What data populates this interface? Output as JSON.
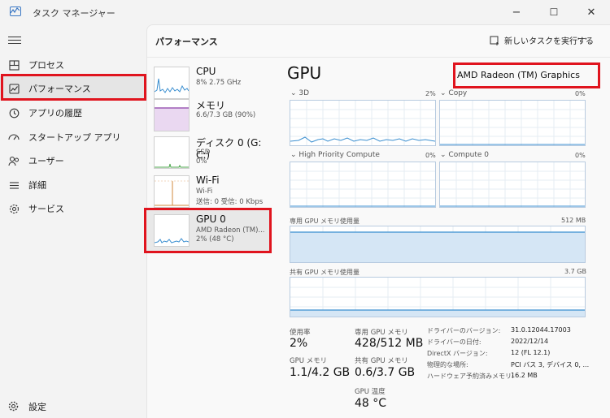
{
  "app": {
    "title": "タスク マネージャー",
    "minimize": "−",
    "maximize": "☐",
    "close": "✕"
  },
  "sidebar": {
    "items": [
      {
        "label": "プロセス",
        "icon": "processes-icon"
      },
      {
        "label": "パフォーマンス",
        "icon": "performance-icon"
      },
      {
        "label": "アプリの履歴",
        "icon": "app-history-icon"
      },
      {
        "label": "スタートアップ アプリ",
        "icon": "startup-icon"
      },
      {
        "label": "ユーザー",
        "icon": "users-icon"
      },
      {
        "label": "詳細",
        "icon": "details-icon"
      },
      {
        "label": "サービス",
        "icon": "services-icon"
      }
    ],
    "settings_label": "設定"
  },
  "header": {
    "title": "パフォーマンス",
    "run_task": "新しいタスクを実行する",
    "more": "⋯"
  },
  "devices": [
    {
      "name": "CPU",
      "sub1": "8%  2.75 GHz",
      "sub2": ""
    },
    {
      "name": "メモリ",
      "sub1": "6.6/7.3 GB (90%)",
      "sub2": ""
    },
    {
      "name": "ディスク 0 (G: C:)",
      "sub1": "SSD",
      "sub2": "0%"
    },
    {
      "name": "Wi-Fi",
      "sub1": "Wi-Fi",
      "sub2": "送信: 0 受信: 0 Kbps"
    },
    {
      "name": "GPU 0",
      "sub1": "AMD Radeon (TM)...",
      "sub2": "2% (48 °C)"
    }
  ],
  "detail": {
    "title": "GPU",
    "model": "AMD Radeon (TM) Graphics",
    "engines": [
      {
        "label": "3D",
        "pct": "2%"
      },
      {
        "label": "Copy",
        "pct": "0%"
      },
      {
        "label": "High Priority Compute",
        "pct": "0%"
      },
      {
        "label": "Compute 0",
        "pct": "0%"
      }
    ],
    "dedicated_label": "専用 GPU メモリ使用量",
    "dedicated_max": "512 MB",
    "shared_label": "共有 GPU メモリ使用量",
    "shared_max": "3.7 GB",
    "stats": {
      "usage_label": "使用率",
      "usage": "2%",
      "gpu_mem_label": "GPU メモリ",
      "gpu_mem": "1.1/4.2 GB",
      "ded_mem_label": "専用 GPU メモリ",
      "ded_mem": "428/512 MB",
      "shared_mem_label": "共有 GPU メモリ",
      "shared_mem": "0.6/3.7 GB",
      "temp_label": "GPU 温度",
      "temp": "48 °C"
    },
    "info": [
      {
        "k": "ドライバーのバージョン:",
        "v": "31.0.12044.17003"
      },
      {
        "k": "ドライバーの日付:",
        "v": "2022/12/14"
      },
      {
        "k": "DirectX バージョン:",
        "v": "12 (FL 12.1)"
      },
      {
        "k": "物理的な場所:",
        "v": "PCI バス 3, デバイス 0, ..."
      },
      {
        "k": "ハードウェア予約済みメモリ:",
        "v": "16.2 MB"
      }
    ]
  },
  "colors": {
    "accent": "#3b8fd0",
    "highlight": "#e0141e",
    "memory": "#8b3fa8",
    "disk": "#4ca64c",
    "wifi": "#d28a3c"
  }
}
